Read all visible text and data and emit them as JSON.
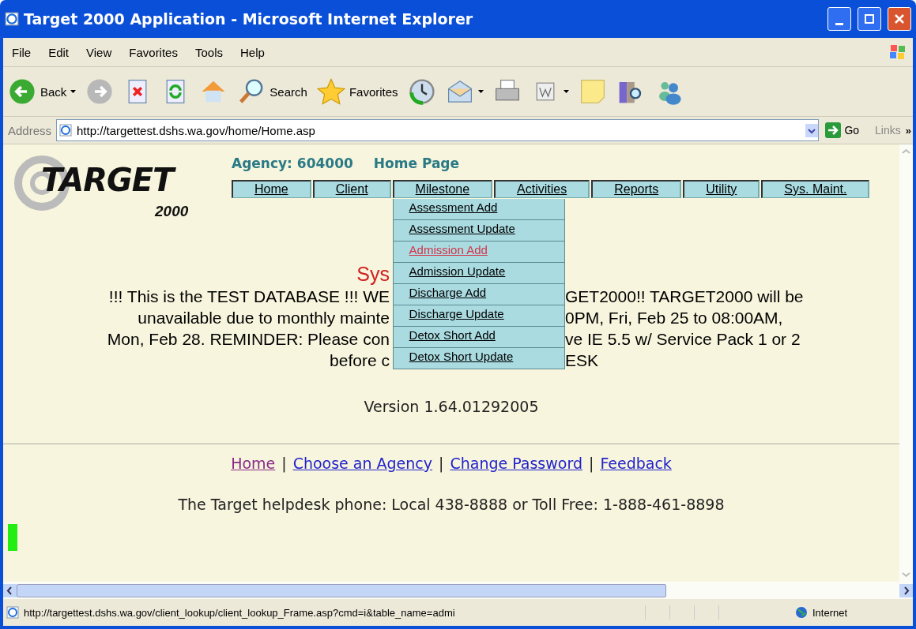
{
  "window": {
    "title": "Target 2000 Application - Microsoft Internet Explorer"
  },
  "menu_bar": [
    "File",
    "Edit",
    "View",
    "Favorites",
    "Tools",
    "Help"
  ],
  "toolbar": [
    {
      "kind": "back",
      "label": "Back"
    },
    {
      "kind": "forward"
    },
    {
      "kind": "stop"
    },
    {
      "kind": "refresh"
    },
    {
      "kind": "home"
    },
    {
      "kind": "search",
      "label": "Search"
    },
    {
      "kind": "favorites",
      "label": "Favorites"
    },
    {
      "kind": "history"
    },
    {
      "kind": "mail"
    },
    {
      "kind": "print"
    },
    {
      "kind": "edit"
    },
    {
      "kind": "note"
    },
    {
      "kind": "research"
    },
    {
      "kind": "messenger"
    }
  ],
  "address_bar": {
    "label": "Address",
    "value": "http://targettest.dshs.wa.gov/home/Home.asp",
    "go": "Go",
    "links": "Links",
    "more": "»"
  },
  "page": {
    "logo": {
      "word": "TARGET",
      "year": "2000"
    },
    "agency": "Agency: 604000",
    "page_title": "Home Page",
    "nav": [
      {
        "label": "Home"
      },
      {
        "label": "Client"
      },
      {
        "label": "Milestone",
        "menu": [
          {
            "label": "Assessment Add",
            "highlighted": false
          },
          {
            "label": "Assessment Update",
            "highlighted": false
          },
          {
            "label": "Admission Add",
            "highlighted": true
          },
          {
            "label": "Admission Update",
            "highlighted": false
          },
          {
            "label": "Discharge Add",
            "highlighted": false
          },
          {
            "label": "Discharge Update",
            "highlighted": false
          },
          {
            "label": "Detox Short Add",
            "highlighted": false
          },
          {
            "label": "Detox Short Update",
            "highlighted": false
          }
        ]
      },
      {
        "label": "Activities"
      },
      {
        "label": "Reports"
      },
      {
        "label": "Utility"
      },
      {
        "label": "Sys. Maint."
      }
    ],
    "notice_title": "Sys",
    "notice_lines": [
      {
        "left": "!!! This is the TEST DATABASE !!! WE",
        "right": "GET2000!! TARGET2000 will be"
      },
      {
        "left": "unavailable due to monthly mainte",
        "right": "0PM, Fri, Feb 25 to 08:00AM,"
      },
      {
        "left": "Mon, Feb 28. REMINDER: Please con",
        "right": "ve IE 5.5 w/ Service Pack 1 or 2"
      },
      {
        "left": "before c",
        "right": "ESK"
      }
    ],
    "version": "Version 1.64.01292005",
    "footer_links": [
      {
        "kind": "link",
        "label": "Home",
        "visited": true
      },
      {
        "kind": "separator",
        "label": "|"
      },
      {
        "kind": "link",
        "label": "Choose an Agency",
        "visited": false
      },
      {
        "kind": "separator",
        "label": "|"
      },
      {
        "kind": "link",
        "label": "Change Password",
        "visited": false
      },
      {
        "kind": "separator",
        "label": "|"
      },
      {
        "kind": "link",
        "label": "Feedback",
        "visited": false
      }
    ],
    "helpdesk": "The Target helpdesk phone: Local 438-8888 or Toll Free: 1-888-461-8898"
  },
  "status_bar": {
    "url": "http://targettest.dshs.wa.gov/client_lookup/client_lookup_Frame.asp?cmd=i&table_name=admi",
    "zone": "Internet"
  }
}
